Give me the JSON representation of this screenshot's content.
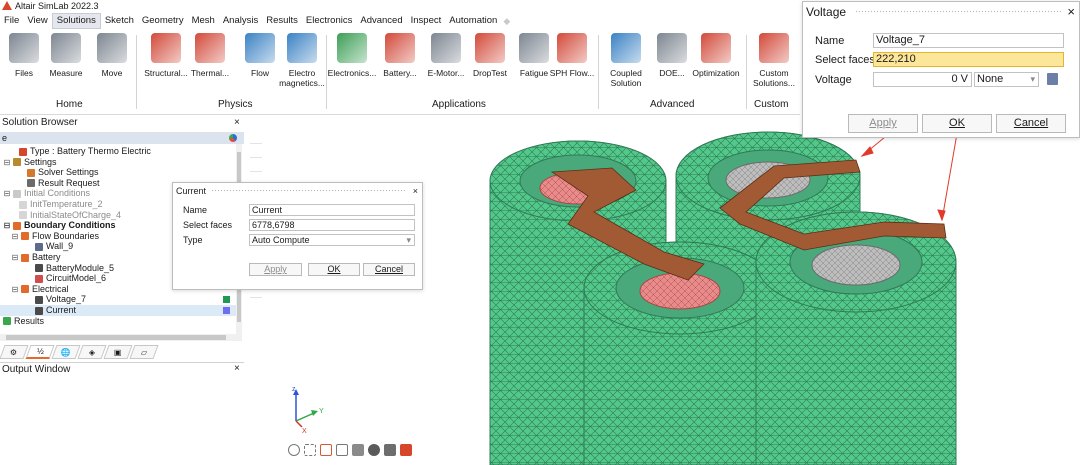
{
  "app": {
    "title": "Altair SimLab 2022.3"
  },
  "menu": [
    "File",
    "View",
    "Solutions",
    "Sketch",
    "Geometry",
    "Mesh",
    "Analysis",
    "Results",
    "Electronics",
    "Advanced",
    "Inspect",
    "Automation"
  ],
  "menu_active": "Solutions",
  "ribbon": {
    "home": {
      "label": "Home",
      "items": [
        "Files",
        "Measure",
        "Move"
      ]
    },
    "physics": {
      "label": "Physics",
      "items": [
        "Structural...",
        "Thermal...",
        "Flow",
        "Electro\nmagnetics..."
      ]
    },
    "applications": {
      "label": "Applications",
      "items": [
        "Electronics...",
        "Battery...",
        "E-Motor...",
        "DropTest",
        "Fatigue",
        "SPH Flow..."
      ]
    },
    "advanced": {
      "label": "Advanced",
      "items": [
        "Coupled\nSolution",
        "DOE...",
        "Optimization"
      ]
    },
    "custom": {
      "label": "Custom",
      "items": [
        "Custom\nSolutions..."
      ]
    },
    "colors": {
      "blue": "#3b82c4",
      "red": "#d24a3a",
      "grey": "#7d8691",
      "green": "#3c9e56"
    }
  },
  "solution_browser": {
    "title": "Solution Browser",
    "column_header": "e",
    "tree": [
      {
        "text": "Type : Battery Thermo Electric",
        "indent": 2,
        "icon": "#d6462a"
      },
      {
        "text": "Settings",
        "indent": 0,
        "icon": "#b78a2e",
        "twist": "⊟"
      },
      {
        "text": "Solver Settings",
        "indent": 3,
        "icon": "#d6782a"
      },
      {
        "text": "Result Request",
        "indent": 3,
        "icon": "#6b6b6b"
      },
      {
        "text": "Initial Conditions",
        "indent": 0,
        "icon": "#c9c9c9",
        "twist": "⊟",
        "grey": true
      },
      {
        "text": "InitTemperature_2",
        "indent": 2,
        "icon": "#d6d6d6",
        "grey": true
      },
      {
        "text": "InitialStateOfCharge_4",
        "indent": 2,
        "icon": "#d6d6d6",
        "grey": true
      },
      {
        "text": "Boundary Conditions",
        "indent": 0,
        "icon": "#e26b2b",
        "twist": "⊟",
        "bold": true
      },
      {
        "text": "Flow Boundaries",
        "indent": 1,
        "icon": "#e26b2b",
        "twist": "⊟"
      },
      {
        "text": "Wall_9",
        "indent": 4,
        "icon": "#5a6b8c"
      },
      {
        "text": "Battery",
        "indent": 1,
        "icon": "#e26b2b",
        "twist": "⊟"
      },
      {
        "text": "BatteryModule_5",
        "indent": 4,
        "icon": "#4a4a4a"
      },
      {
        "text": "CircuitModel_6",
        "indent": 4,
        "icon": "#d14d4d"
      },
      {
        "text": "Electrical",
        "indent": 1,
        "icon": "#e26b2b",
        "twist": "⊟"
      },
      {
        "text": "Voltage_7",
        "indent": 4,
        "icon": "#4a4a4a",
        "swatch": "#1f9a54"
      },
      {
        "text": "Current",
        "indent": 4,
        "icon": "#4a4a4a",
        "swatch": "#6e6ef2",
        "selected": true
      },
      {
        "text": "Results",
        "indent": 0,
        "icon": "#39a84a"
      }
    ],
    "tabs": [
      "⚙",
      "½",
      "🌐",
      "◈",
      "▣",
      "▱"
    ]
  },
  "output_window": {
    "title": "Output Window"
  },
  "current_dialog": {
    "title": "Current",
    "name_label": "Name",
    "name_value": "Current",
    "faces_label": "Select faces",
    "faces_value": "6778,6798",
    "type_label": "Type",
    "type_value": "Auto Compute",
    "apply": "Apply",
    "ok": "OK",
    "cancel": "Cancel"
  },
  "voltage_dialog": {
    "title": "Voltage",
    "name_label": "Name",
    "name_value": "Voltage_7",
    "faces_label": "Select faces",
    "faces_value": "222,210",
    "voltage_label": "Voltage",
    "voltage_value": "0 V",
    "unit_select": "None",
    "apply": "Apply",
    "ok": "OK",
    "cancel": "Cancel"
  },
  "viewport": {
    "axes": {
      "z": "z",
      "y": "Y",
      "x": "X"
    },
    "cell_color": "#52c98a",
    "strap_color": "#a25a35",
    "terminal_color": "#e66a6a",
    "arrow_color": "#e23a2a"
  }
}
